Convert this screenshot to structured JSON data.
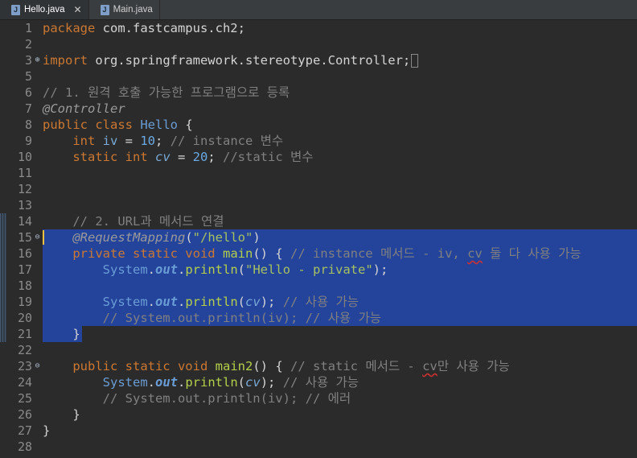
{
  "tabs": [
    {
      "label": "Hello.java",
      "close": "✕"
    },
    {
      "label": "Main.java"
    }
  ],
  "lines": [
    {
      "n": "1",
      "html": "<span class='kw'>package</span> com.fastcampus.ch2;"
    },
    {
      "n": "2",
      "html": ""
    },
    {
      "n": "3",
      "fold": "⊕",
      "html": "<span class='kw'>import</span> org.springframework.stereotype.Controller;<span class='caret'></span>"
    },
    {
      "n": "5",
      "html": ""
    },
    {
      "n": "6",
      "html": "<span class='cmt'>// 1. 원격 호출 가능한 프로그램으로 등록</span>"
    },
    {
      "n": "7",
      "html": "<span class='ann'>@Controller</span>"
    },
    {
      "n": "8",
      "html": "<span class='kw'>public class</span> <span class='cls'>Hello</span> {"
    },
    {
      "n": "9",
      "html": "    <span class='kw'>int</span> <span class='field'>iv</span> = <span class='num'>10</span>; <span class='cmt'>// instance 변수</span>"
    },
    {
      "n": "10",
      "html": "    <span class='kw'>static int</span> <span class='fieldi'>cv</span> = <span class='num'>20</span>; <span class='cmt'>//static 변수</span>"
    },
    {
      "n": "11",
      "html": ""
    },
    {
      "n": "12",
      "html": ""
    },
    {
      "n": "13",
      "html": ""
    },
    {
      "n": "14",
      "gutter": true,
      "html": "    <span class='cmt'>// 2. URL과 메서드 연결</span>"
    },
    {
      "n": "15",
      "gutter": true,
      "fold": "⊖",
      "sel": true,
      "cursor": true,
      "html": "    <span class='ann'>@RequestMapping</span>(<span class='str2'>\"/hello\"</span>)"
    },
    {
      "n": "16",
      "gutter": true,
      "sel": true,
      "html": "    <span class='kw'>private static void</span> <span class='method'>main</span>() { <span class='cmt'>// instance 메서드 - iv, <span class='sq'>cv</span> 둘 다 사용 가능</span>"
    },
    {
      "n": "17",
      "gutter": true,
      "sel": true,
      "html": "        <span class='cls'>System</span>.<span class='outf'>out</span>.<span class='method'>println</span>(<span class='str2'>\"Hello - private\"</span>);"
    },
    {
      "n": "18",
      "gutter": true,
      "sel": true,
      "html": ""
    },
    {
      "n": "19",
      "gutter": true,
      "sel": true,
      "html": "        <span class='cls'>System</span>.<span class='outf'>out</span>.<span class='method'>println</span>(<span class='fieldi'>cv</span>); <span class='cmt'>// 사용 가능</span>"
    },
    {
      "n": "20",
      "gutter": true,
      "sel": true,
      "html": "        <span class='cmt'>// System.out.println(iv); // 사용 가능</span>"
    },
    {
      "n": "21",
      "gutter": true,
      "sel": true,
      "partial": true,
      "html": "    }"
    },
    {
      "n": "22",
      "html": ""
    },
    {
      "n": "23",
      "fold": "⊖",
      "html": "    <span class='kw'>public static void</span> <span class='method'>main2</span>() { <span class='cmt'>// static 메서드 - <span class='sq'>cv</span>만 사용 가능</span>"
    },
    {
      "n": "24",
      "html": "        <span class='cls'>System</span>.<span class='outf'>out</span>.<span class='method'>println</span>(<span class='fieldi'>cv</span>); <span class='cmt'>// 사용 가능</span>"
    },
    {
      "n": "25",
      "html": "        <span class='cmt'>// System.out.println(iv); // 에러</span>"
    },
    {
      "n": "26",
      "html": "    }"
    },
    {
      "n": "27",
      "html": "}"
    },
    {
      "n": "28",
      "html": ""
    }
  ]
}
